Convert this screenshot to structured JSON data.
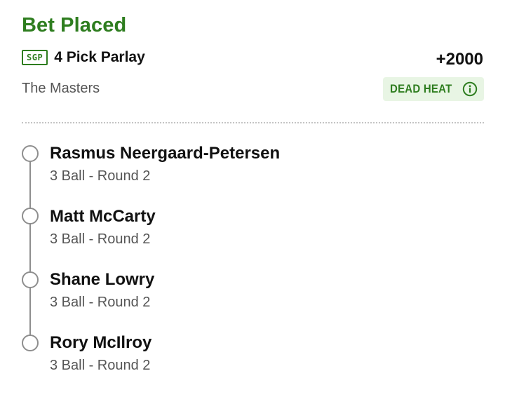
{
  "bet": {
    "status_title": "Bet Placed",
    "badge": "SGP",
    "bet_type": "4 Pick Parlay",
    "odds": "+2000",
    "event": "The Masters",
    "dead_heat_label": "DEAD HEAT",
    "dead_heat_icon": "info-icon"
  },
  "colors": {
    "accent_green": "#2e7d1f",
    "badge_bg": "#e8f5e4",
    "muted_text": "#555555",
    "timeline": "#8e8e8e"
  },
  "legs": [
    {
      "name": "Rasmus Neergaard-Petersen",
      "market": "3 Ball - Round 2"
    },
    {
      "name": "Matt McCarty",
      "market": "3 Ball - Round 2"
    },
    {
      "name": "Shane Lowry",
      "market": "3 Ball - Round 2"
    },
    {
      "name": "Rory McIlroy",
      "market": "3 Ball - Round 2"
    }
  ]
}
